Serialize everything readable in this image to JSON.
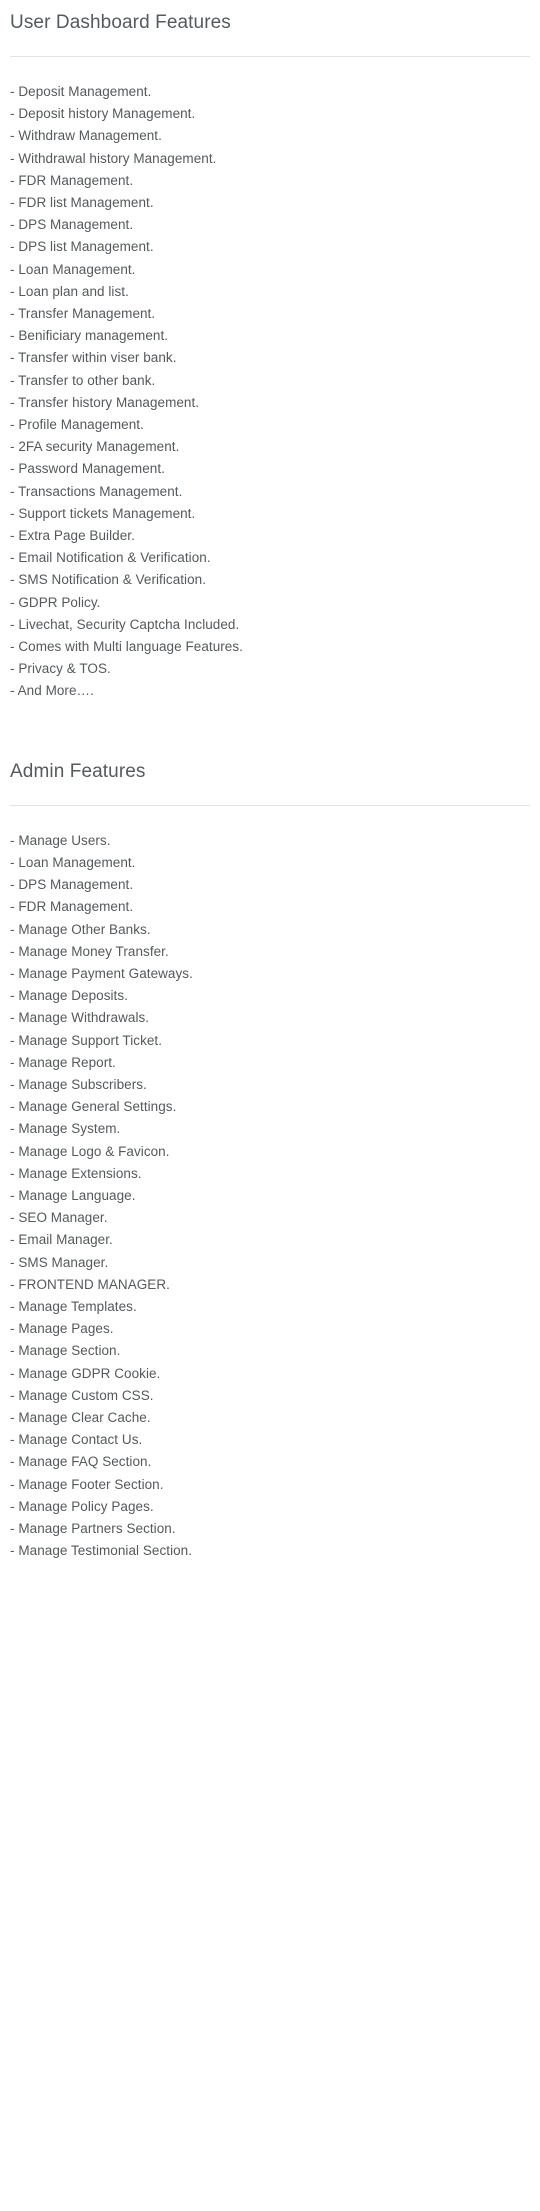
{
  "sections": [
    {
      "title": "User Dashboard Features",
      "items": [
        "- Deposit Management.",
        "- Deposit history Management.",
        "- Withdraw Management.",
        "- Withdrawal history Management.",
        "- FDR Management.",
        "- FDR list Management.",
        "- DPS Management.",
        "- DPS list Management.",
        "- Loan Management.",
        "- Loan plan and list.",
        "- Transfer Management.",
        "- Benificiary management.",
        "- Transfer within viser bank.",
        "- Transfer to other bank.",
        "- Transfer history Management.",
        "- Profile Management.",
        "- 2FA security Management.",
        "- Password Management.",
        "- Transactions Management.",
        "- Support tickets Management.",
        "- Extra Page Builder.",
        "- Email Notification & Verification.",
        "- SMS Notification & Verification.",
        "- GDPR Policy.",
        "- Livechat, Security Captcha Included.",
        "- Comes with Multi language Features.",
        "- Privacy & TOS.",
        "- And More…."
      ]
    },
    {
      "title": "Admin Features",
      "items": [
        "- Manage Users.",
        "- Loan Management.",
        "- DPS Management.",
        "- FDR Management.",
        "- Manage Other Banks.",
        "- Manage Money Transfer.",
        "- Manage Payment Gateways.",
        "- Manage Deposits.",
        "- Manage Withdrawals.",
        "- Manage Support Ticket.",
        "- Manage Report.",
        "- Manage Subscribers.",
        "- Manage General Settings.",
        "- Manage System.",
        "- Manage Logo & Favicon.",
        "- Manage Extensions.",
        "- Manage Language.",
        "- SEO Manager.",
        "- Email Manager.",
        "- SMS Manager.",
        "- FRONTEND MANAGER.",
        "- Manage Templates.",
        "- Manage Pages.",
        "- Manage Section.",
        "- Manage GDPR Cookie.",
        "- Manage Custom CSS.",
        "- Manage Clear Cache.",
        "- Manage Contact Us.",
        "- Manage FAQ Section.",
        "- Manage Footer Section.",
        "- Manage Policy Pages.",
        "- Manage Partners Section.",
        "- Manage Testimonial Section."
      ]
    }
  ],
  "colors": {
    "text": "#55595c",
    "heading": "#555a5e",
    "divider": "#e3e3e3",
    "background": "#ffffff"
  }
}
